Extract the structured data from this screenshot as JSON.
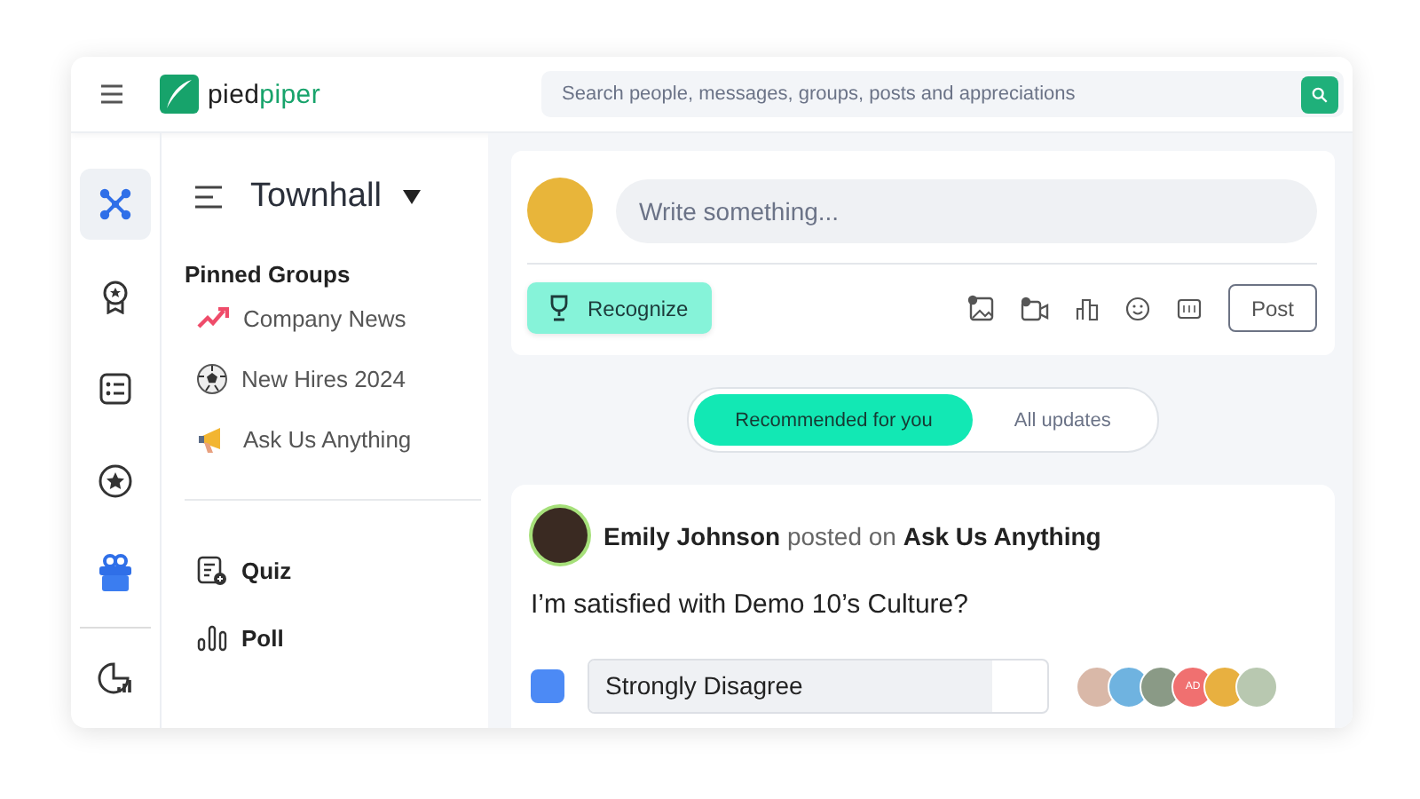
{
  "header": {
    "logo": {
      "prefix": "pied",
      "suffix": "piper"
    },
    "search": {
      "placeholder": "Search people, messages, groups, posts and appreciations"
    }
  },
  "rail": [
    {
      "kind": "network",
      "selected": true
    },
    {
      "kind": "award",
      "selected": false
    },
    {
      "kind": "list",
      "selected": false
    },
    {
      "kind": "star",
      "selected": false
    },
    {
      "kind": "gift",
      "selected": false
    },
    {
      "kind": "analytics",
      "selected": false
    }
  ],
  "sidebar": {
    "title": "Townhall",
    "section_title": "Pinned Groups",
    "groups": [
      {
        "kind": "trend",
        "label": "Company News"
      },
      {
        "kind": "ball",
        "label": "New Hires 2024"
      },
      {
        "kind": "megaphone",
        "label": "Ask Us Anything"
      }
    ],
    "tools": [
      {
        "kind": "quiz",
        "label": "Quiz"
      },
      {
        "kind": "poll",
        "label": "Poll"
      }
    ]
  },
  "composer": {
    "placeholder": "Write something...",
    "recognize": "Recognize",
    "tools": [
      {
        "kind": "image"
      },
      {
        "kind": "video"
      },
      {
        "kind": "chart"
      },
      {
        "kind": "emoji"
      },
      {
        "kind": "gif"
      }
    ],
    "post": "Post"
  },
  "feed_tabs": [
    {
      "label": "Recommended for you",
      "selected": true
    },
    {
      "label": "All updates",
      "selected": false
    }
  ],
  "post": {
    "author": "Emily Johnson",
    "verb": "posted on",
    "group": "Ask Us Anything",
    "question": "I’m satisfied with Demo 10’s Culture?",
    "options": [
      {
        "label": "Strongly Disagree",
        "checked": true,
        "level": 0.88,
        "voters": [
          {
            "kind": "photo",
            "color": "#d9b8a8"
          },
          {
            "kind": "photo",
            "color": "#6fb3e0"
          },
          {
            "kind": "photo",
            "color": "#8a9a86"
          },
          {
            "kind": "initials",
            "initials": "AD",
            "color": "#f07070"
          },
          {
            "kind": "photo",
            "color": "#e8b040"
          },
          {
            "kind": "photo",
            "color": "#b8c8b0"
          }
        ]
      }
    ]
  }
}
